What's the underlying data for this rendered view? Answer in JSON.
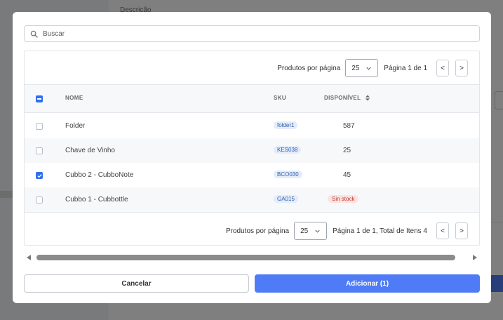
{
  "background": {
    "description_label": "Descrição"
  },
  "search": {
    "placeholder": "Buscar",
    "value": ""
  },
  "pagination_top": {
    "per_page_label": "Produtos por página",
    "per_page_value": "25",
    "page_info": "Página 1 de 1",
    "prev_label": "<",
    "next_label": ">"
  },
  "table": {
    "columns": {
      "nome": "NOME",
      "sku": "SKU",
      "disponivel": "DISPONÍVEL"
    },
    "rows": [
      {
        "name": "Folder",
        "sku": "folder1",
        "available": "587",
        "checked": false
      },
      {
        "name": "Chave de Vinho",
        "sku": "KES038",
        "available": "25",
        "checked": false
      },
      {
        "name": "Cubbo 2 - CubboNote",
        "sku": "BCO030",
        "available": "45",
        "checked": true
      },
      {
        "name": "Cubbo 1 - Cubbottle",
        "sku": "GA015",
        "available": "Sin stock",
        "checked": false
      }
    ]
  },
  "pagination_bottom": {
    "per_page_label": "Produtos por página",
    "per_page_value": "25",
    "page_info": "Página 1 de 1, Total de Itens 4",
    "prev_label": "<",
    "next_label": ">"
  },
  "actions": {
    "cancel_label": "Cancelar",
    "add_label": "Adicionar (1)"
  },
  "colors": {
    "primary": "#4f7cf6",
    "checkbox": "#2f6ff0",
    "sku_badge_bg": "#e4ecfb",
    "no_stock_bg": "#fde2e2",
    "no_stock_text": "#c0392b"
  }
}
